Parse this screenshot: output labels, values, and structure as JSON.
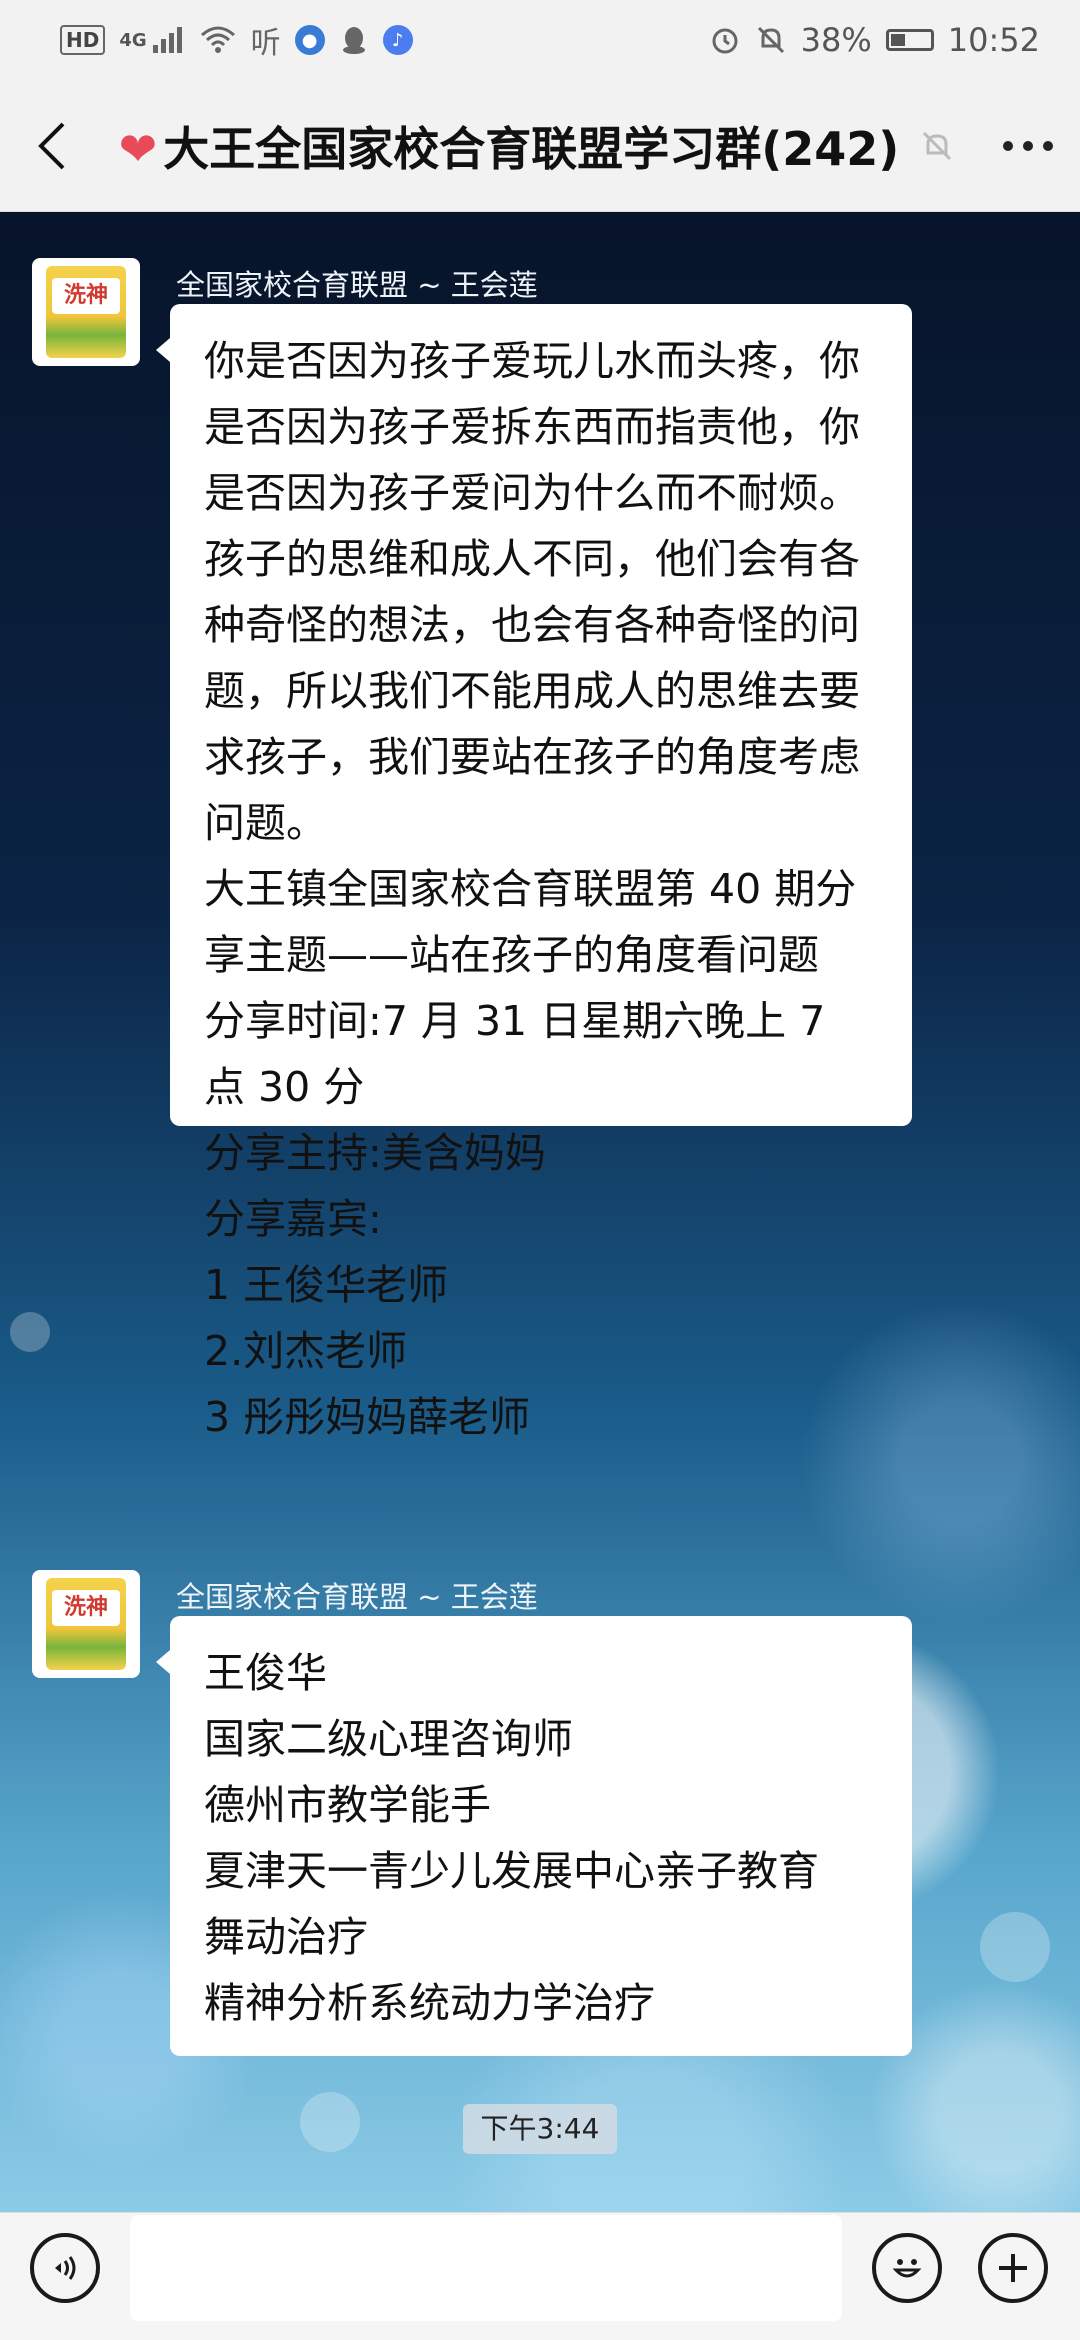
{
  "status_bar": {
    "hd": "HD",
    "network": "4G",
    "battery_percent": "38%",
    "battery_level": 0.38,
    "time": "10:52"
  },
  "header": {
    "heart_icon": "❤",
    "title": "大王全国家校合育联盟学习群(242)"
  },
  "messages": [
    {
      "sender": "全国家校合育联盟 ~ 王会莲",
      "lines": [
        "你是否因为孩子爱玩儿水而头疼，你是否因为孩子爱拆东西而指责他，你是否因为孩子爱问为什么而不耐烦。孩子的思维和成人不同，他们会有各种奇怪的想法，也会有各种奇怪的问题，所以我们不能用成人的思维去要求孩子，我们要站在孩子的角度考虑问题。",
        "大王镇全国家校合育联盟第 40 期分享主题——站在孩子的角度看问题",
        "分享时间:7 月 31 日星期六晚上 7 点 30 分",
        "分享主持:美含妈妈",
        "分享嘉宾:",
        "1 王俊华老师",
        "2.刘杰老师",
        "3 彤彤妈妈薛老师"
      ]
    },
    {
      "sender": "全国家校合育联盟 ~ 王会莲",
      "lines": [
        "王俊华",
        "国家二级心理咨询师",
        "德州市教学能手",
        "夏津天一青少儿发展中心亲子教育",
        "舞动治疗",
        "精神分析系统动力学治疗"
      ]
    }
  ],
  "timestamp": "下午3:44",
  "avatar_label": "洗神"
}
